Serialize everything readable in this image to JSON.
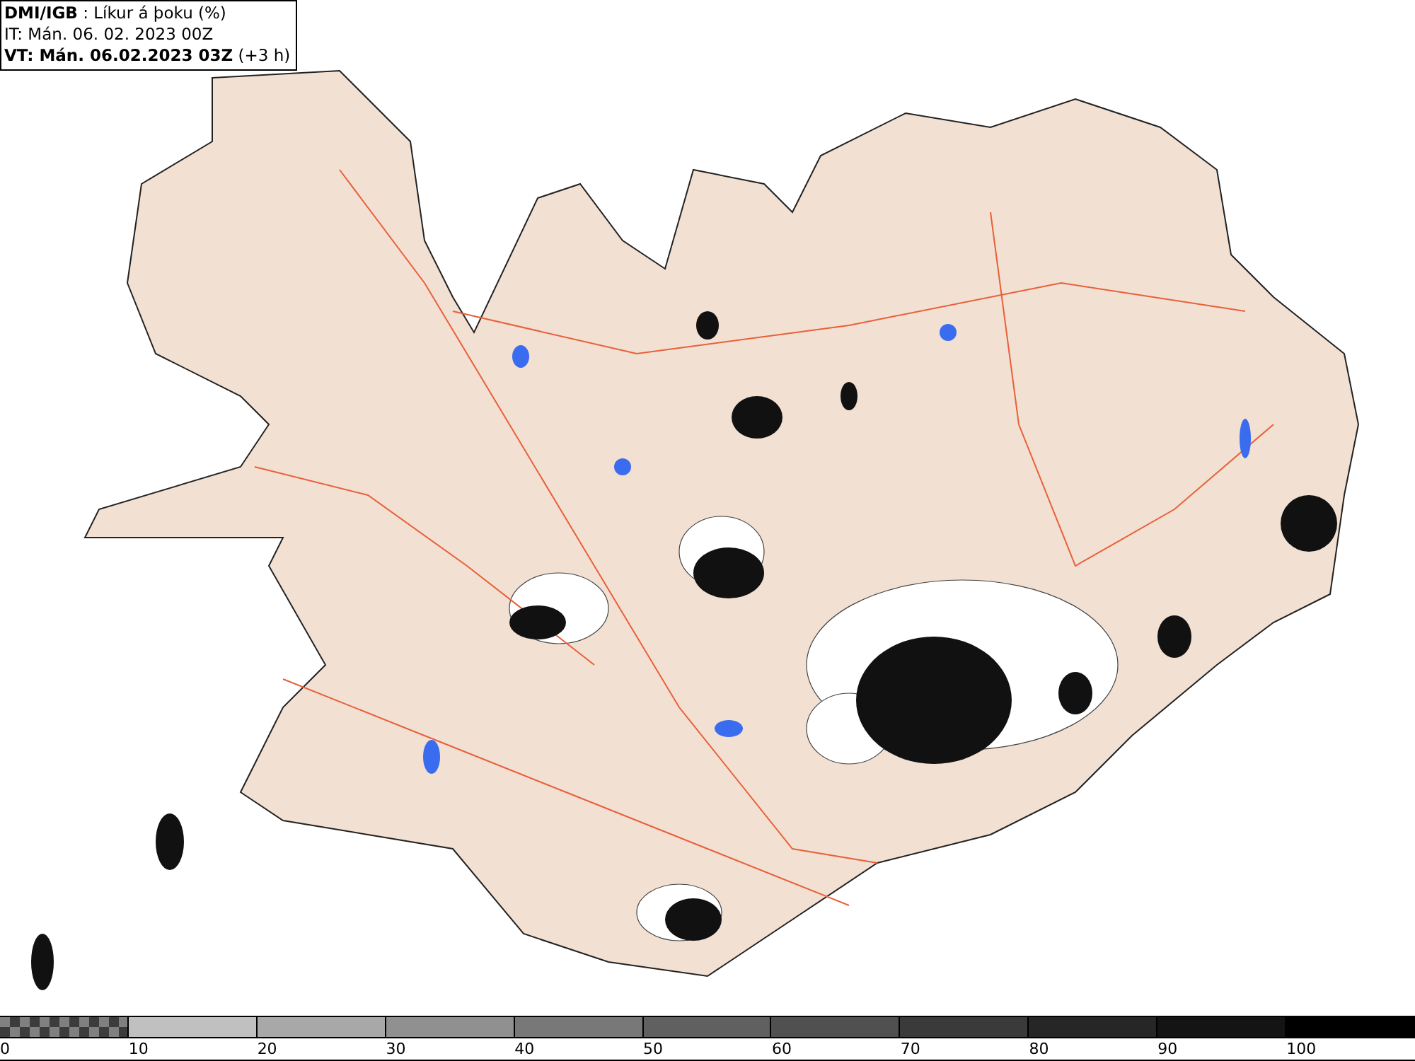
{
  "header": {
    "source": "DMI/IGB",
    "title": ": Líkur á þoku (%)",
    "issue_time": "IT: Mán. 06. 02. 2023 00Z",
    "valid_time": "VT: Mán. 06.02.2023 03Z",
    "offset": "(+3 h)"
  },
  "legend": [
    {
      "kind": "checker",
      "label": "0"
    },
    {
      "kind": "solid",
      "color": "#c0c0c0",
      "label": "10"
    },
    {
      "kind": "solid",
      "color": "#a8a8a8",
      "label": "20"
    },
    {
      "kind": "solid",
      "color": "#909090",
      "label": "30"
    },
    {
      "kind": "solid",
      "color": "#787878",
      "label": "40"
    },
    {
      "kind": "solid",
      "color": "#606060",
      "label": "50"
    },
    {
      "kind": "solid",
      "color": "#505050",
      "label": "60"
    },
    {
      "kind": "solid",
      "color": "#3a3a3a",
      "label": "70"
    },
    {
      "kind": "solid",
      "color": "#262626",
      "label": "80"
    },
    {
      "kind": "solid",
      "color": "#141414",
      "label": "90"
    },
    {
      "kind": "solid",
      "color": "#000000",
      "label": "100"
    }
  ]
}
